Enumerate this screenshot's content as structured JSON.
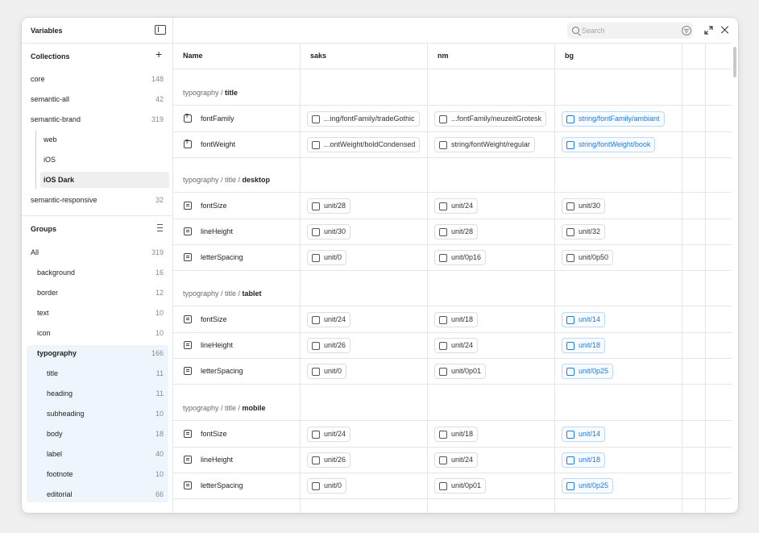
{
  "sidebar": {
    "title": "Variables",
    "collections_label": "Collections",
    "collections": [
      {
        "label": "core",
        "count": "148"
      },
      {
        "label": "semantic-all",
        "count": "42"
      },
      {
        "label": "semantic-brand",
        "count": "319"
      },
      {
        "label": "web",
        "count": ""
      },
      {
        "label": "iOS",
        "count": ""
      },
      {
        "label": "iOS Dark",
        "count": ""
      },
      {
        "label": "semantic-responsive",
        "count": "32"
      }
    ],
    "groups_label": "Groups",
    "groups": [
      {
        "label": "All",
        "count": "319"
      },
      {
        "label": "background",
        "count": "16"
      },
      {
        "label": "border",
        "count": "12"
      },
      {
        "label": "text",
        "count": "10"
      },
      {
        "label": "icon",
        "count": "10"
      },
      {
        "label": "typography",
        "count": "166"
      },
      {
        "label": "title",
        "count": "11"
      },
      {
        "label": "heading",
        "count": "11"
      },
      {
        "label": "subheading",
        "count": "10"
      },
      {
        "label": "body",
        "count": "18"
      },
      {
        "label": "label",
        "count": "40"
      },
      {
        "label": "footnote",
        "count": "10"
      },
      {
        "label": "editorial",
        "count": "66"
      }
    ]
  },
  "toolbar": {
    "search_placeholder": "Search"
  },
  "table": {
    "headers": [
      "Name",
      "saks",
      "nm",
      "bg"
    ],
    "groups": [
      {
        "path": "typography / ",
        "leaf": "title",
        "rows": [
          {
            "name": "fontFamily",
            "type": "string",
            "values": [
              "...ing/fontFamily/tradeGothic",
              "...fontFamily/neuzeitGrotesk",
              "string/fontFamily/ambiant"
            ]
          },
          {
            "name": "fontWeight",
            "type": "string",
            "values": [
              "...ontWeight/boldCondensed",
              "string/fontWeight/regular",
              "string/fontWeight/book"
            ]
          }
        ]
      },
      {
        "path": "typography / title / ",
        "leaf": "desktop",
        "rows": [
          {
            "name": "fontSize",
            "type": "number",
            "values": [
              "unit/28",
              "unit/24",
              "unit/30"
            ]
          },
          {
            "name": "lineHeight",
            "type": "number",
            "values": [
              "unit/30",
              "unit/28",
              "unit/32"
            ]
          },
          {
            "name": "letterSpacing",
            "type": "number",
            "values": [
              "unit/0",
              "unit/0p16",
              "unit/0p50"
            ]
          }
        ]
      },
      {
        "path": "typography / title / ",
        "leaf": "tablet",
        "rows": [
          {
            "name": "fontSize",
            "type": "number",
            "values": [
              "unit/24",
              "unit/18",
              "unit/14"
            ]
          },
          {
            "name": "lineHeight",
            "type": "number",
            "values": [
              "unit/26",
              "unit/24",
              "unit/18"
            ]
          },
          {
            "name": "letterSpacing",
            "type": "number",
            "values": [
              "unit/0",
              "unit/0p01",
              "unit/0p25"
            ]
          }
        ]
      },
      {
        "path": "typography / title / ",
        "leaf": "mobile",
        "rows": [
          {
            "name": "fontSize",
            "type": "number",
            "values": [
              "unit/24",
              "unit/18",
              "unit/14"
            ]
          },
          {
            "name": "lineHeight",
            "type": "number",
            "values": [
              "unit/26",
              "unit/24",
              "unit/18"
            ]
          },
          {
            "name": "letterSpacing",
            "type": "number",
            "values": [
              "unit/0",
              "unit/0p01",
              "unit/0p25"
            ]
          }
        ]
      }
    ]
  },
  "colors": {
    "accent": "#1a7de0",
    "selected_group_bg": "#eef5fc",
    "selected_collection_bg": "#efefef"
  }
}
